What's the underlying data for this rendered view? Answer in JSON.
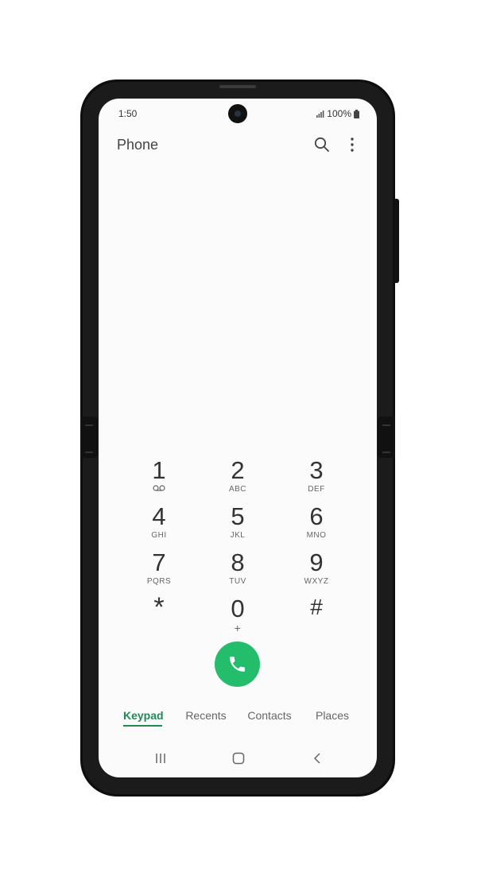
{
  "status": {
    "time": "1:50",
    "battery": "100%"
  },
  "header": {
    "title": "Phone"
  },
  "icons": {
    "search": "search-icon",
    "more": "more-vert-icon",
    "voicemail": "voicemail-icon",
    "call": "phone-icon",
    "recents_nav": "recents-nav-icon",
    "home_nav": "home-nav-icon",
    "back_nav": "back-nav-icon"
  },
  "keypad": [
    {
      "digit": "1",
      "letters": ""
    },
    {
      "digit": "2",
      "letters": "ABC"
    },
    {
      "digit": "3",
      "letters": "DEF"
    },
    {
      "digit": "4",
      "letters": "GHI"
    },
    {
      "digit": "5",
      "letters": "JKL"
    },
    {
      "digit": "6",
      "letters": "MNO"
    },
    {
      "digit": "7",
      "letters": "PQRS"
    },
    {
      "digit": "8",
      "letters": "TUV"
    },
    {
      "digit": "9",
      "letters": "WXYZ"
    },
    {
      "digit": "*",
      "letters": ""
    },
    {
      "digit": "0",
      "letters": "+"
    },
    {
      "digit": "#",
      "letters": ""
    }
  ],
  "tabs": [
    {
      "label": "Keypad",
      "active": true
    },
    {
      "label": "Recents",
      "active": false
    },
    {
      "label": "Contacts",
      "active": false
    },
    {
      "label": "Places",
      "active": false
    }
  ],
  "colors": {
    "accent": "#1f8a55",
    "call": "#23bd6b",
    "phone_frame": "#0e0e0e"
  }
}
